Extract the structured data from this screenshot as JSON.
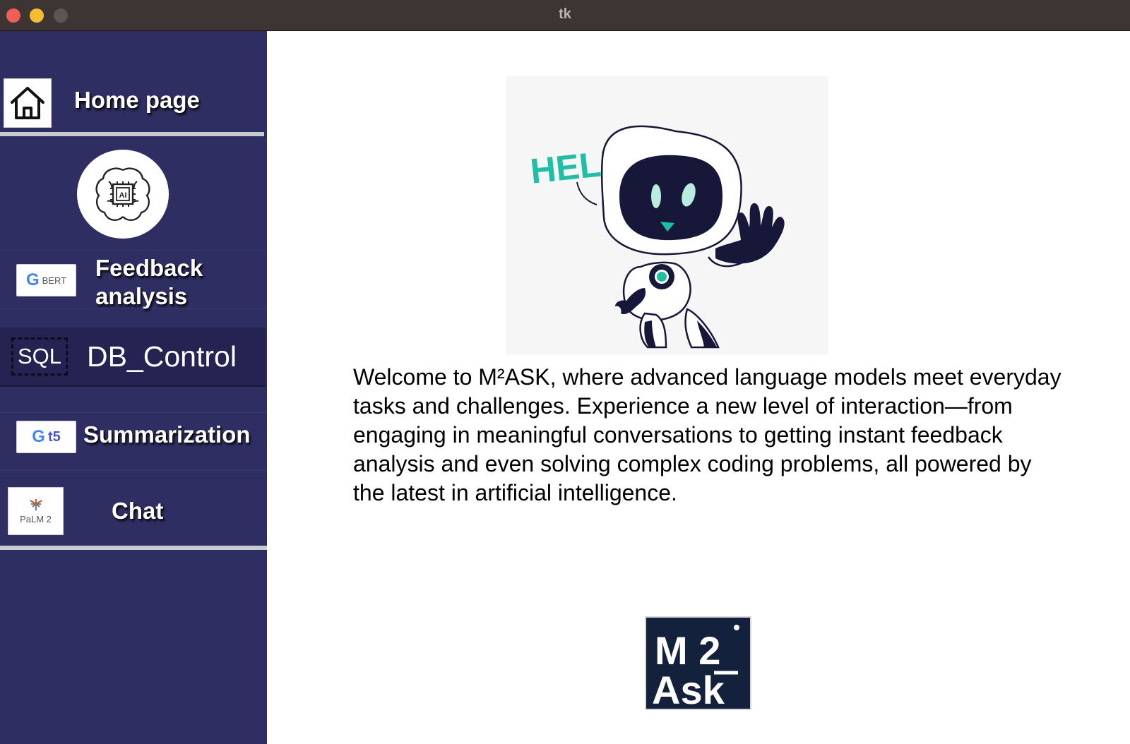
{
  "window": {
    "title": "tk"
  },
  "sidebar": {
    "home": {
      "label": "Home page",
      "icon": "home-icon"
    },
    "ai_logo": {
      "icon": "ai-brain-chip-icon",
      "text": "AI"
    },
    "feedback": {
      "label_line1": "Feedback",
      "label_line2": "analysis",
      "logo_text": "BERT",
      "logo_letter": "G"
    },
    "db_control": {
      "label": "DB_Control",
      "logo_text": "SQL"
    },
    "summarization": {
      "label": "Summarization",
      "logo_text": "t5",
      "logo_letter": "G"
    },
    "chat": {
      "label": "Chat",
      "logo_text": "PaLM 2"
    }
  },
  "main": {
    "robot_caption": "HELLO!",
    "welcome_text": "Welcome to M²ASK, where advanced language models meet everyday tasks and challenges. Experience a new level of interaction—from engaging in meaningful conversations to getting instant feedback analysis and even solving complex coding problems, all powered by the latest in artificial intelligence.",
    "logo_top": "M 2",
    "logo_bottom": "Ask"
  },
  "colors": {
    "sidebar_bg": "#2e2e62",
    "title_bar": "#3d3434",
    "robot_teal": "#1fbfa5",
    "robot_navy": "#17173a"
  }
}
